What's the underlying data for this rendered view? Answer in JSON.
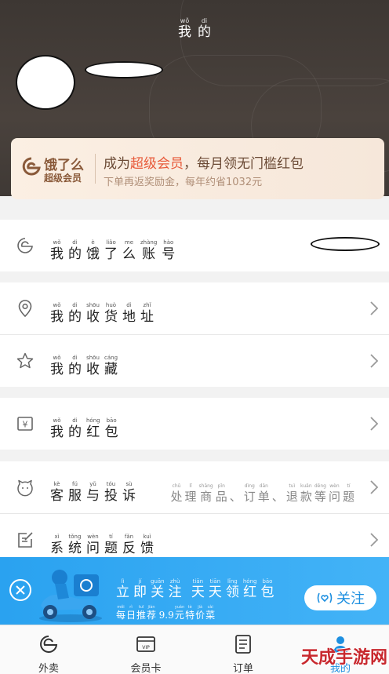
{
  "header": {
    "title": [
      {
        "p": "wǒ",
        "c": "我"
      },
      {
        "p": "di",
        "c": "的"
      }
    ]
  },
  "vip": {
    "logo_line1": "饿了么",
    "logo_line2": "超级会员",
    "line1_prefix": "成为",
    "line1_highlight": "超级会员",
    "line1_suffix": "，每月领无门槛红包",
    "line2": "下单再返奖励金，每年约省1032元"
  },
  "rows": {
    "account": {
      "icon": "eleme-icon",
      "label": [
        {
          "p": "wǒ",
          "c": "我"
        },
        {
          "p": "di",
          "c": "的"
        },
        {
          "p": "è",
          "c": "饿"
        },
        {
          "p": "liǎo",
          "c": "了"
        },
        {
          "p": "me",
          "c": "么"
        },
        {
          "p": "zhàng",
          "c": "账"
        },
        {
          "p": "hào",
          "c": "号"
        }
      ]
    },
    "address": {
      "icon": "location-pin-icon",
      "label": [
        {
          "p": "wǒ",
          "c": "我"
        },
        {
          "p": "di",
          "c": "的"
        },
        {
          "p": "shōu",
          "c": "收"
        },
        {
          "p": "huò",
          "c": "货"
        },
        {
          "p": "dì",
          "c": "地"
        },
        {
          "p": "zhǐ",
          "c": "址"
        }
      ]
    },
    "favorites": {
      "icon": "star-icon",
      "label": [
        {
          "p": "wǒ",
          "c": "我"
        },
        {
          "p": "di",
          "c": "的"
        },
        {
          "p": "shōu",
          "c": "收"
        },
        {
          "p": "cáng",
          "c": "藏"
        }
      ]
    },
    "redpacket": {
      "icon": "yen-icon",
      "label": [
        {
          "p": "wǒ",
          "c": "我"
        },
        {
          "p": "di",
          "c": "的"
        },
        {
          "p": "hóng",
          "c": "红"
        },
        {
          "p": "bāo",
          "c": "包"
        }
      ]
    },
    "service": {
      "icon": "service-face-icon",
      "label": [
        {
          "p": "kè",
          "c": "客"
        },
        {
          "p": "fú",
          "c": "服"
        },
        {
          "p": "yǔ",
          "c": "与"
        },
        {
          "p": "tóu",
          "c": "投"
        },
        {
          "p": "sù",
          "c": "诉"
        }
      ],
      "extra": [
        {
          "p": "chǔ",
          "c": "处"
        },
        {
          "p": "lǐ",
          "c": "理"
        },
        {
          "p": "shāng",
          "c": "商"
        },
        {
          "p": "pǐn",
          "c": "品"
        },
        {
          "p": "",
          "c": "、"
        },
        {
          "p": "dìng",
          "c": "订"
        },
        {
          "p": "dān",
          "c": "单"
        },
        {
          "p": "",
          "c": "、"
        },
        {
          "p": "tuì",
          "c": "退"
        },
        {
          "p": "kuǎn",
          "c": "款"
        },
        {
          "p": "děng",
          "c": "等"
        },
        {
          "p": "wèn",
          "c": "问"
        },
        {
          "p": "tí",
          "c": "题"
        }
      ]
    },
    "feedback": {
      "icon": "feedback-edit-icon",
      "label": [
        {
          "p": "xì",
          "c": "系"
        },
        {
          "p": "tǒng",
          "c": "统"
        },
        {
          "p": "wèn",
          "c": "问"
        },
        {
          "p": "tí",
          "c": "题"
        },
        {
          "p": "fǎn",
          "c": "反"
        },
        {
          "p": "kuì",
          "c": "馈"
        }
      ]
    }
  },
  "banner": {
    "title": [
      {
        "p": "lì",
        "c": "立"
      },
      {
        "p": "jí",
        "c": "即"
      },
      {
        "p": "guān",
        "c": "关"
      },
      {
        "p": "zhù",
        "c": "注"
      },
      {
        "p": "",
        "c": " "
      },
      {
        "p": "tiān",
        "c": "天"
      },
      {
        "p": "tiān",
        "c": "天"
      },
      {
        "p": "lǐng",
        "c": "领"
      },
      {
        "p": "hóng",
        "c": "红"
      },
      {
        "p": "bāo",
        "c": "包"
      }
    ],
    "subtitle": [
      {
        "p": "měi",
        "c": "每"
      },
      {
        "p": "rì",
        "c": "日"
      },
      {
        "p": "tuī",
        "c": "推"
      },
      {
        "p": "jiàn",
        "c": "荐"
      },
      {
        "p": "",
        "c": " "
      },
      {
        "p": "",
        "c": "9.9"
      },
      {
        "p": "yuán",
        "c": "元"
      },
      {
        "p": "tè",
        "c": "特"
      },
      {
        "p": "jià",
        "c": "价"
      },
      {
        "p": "cài",
        "c": "菜"
      }
    ],
    "follow_label": "关注"
  },
  "tabs": [
    {
      "label": "外卖",
      "icon": "eleme-icon"
    },
    {
      "label": "会员卡",
      "icon": "vip-card-icon"
    },
    {
      "label": "订单",
      "icon": "order-list-icon"
    },
    {
      "label": "我的",
      "icon": "profile-icon"
    }
  ],
  "watermark": "天成手游网",
  "colors": {
    "header_bg": "#3d3733",
    "vip_highlight": "#e85a3a",
    "banner_bg": "#2aa2f0",
    "follow_text": "#1d8fe0"
  }
}
